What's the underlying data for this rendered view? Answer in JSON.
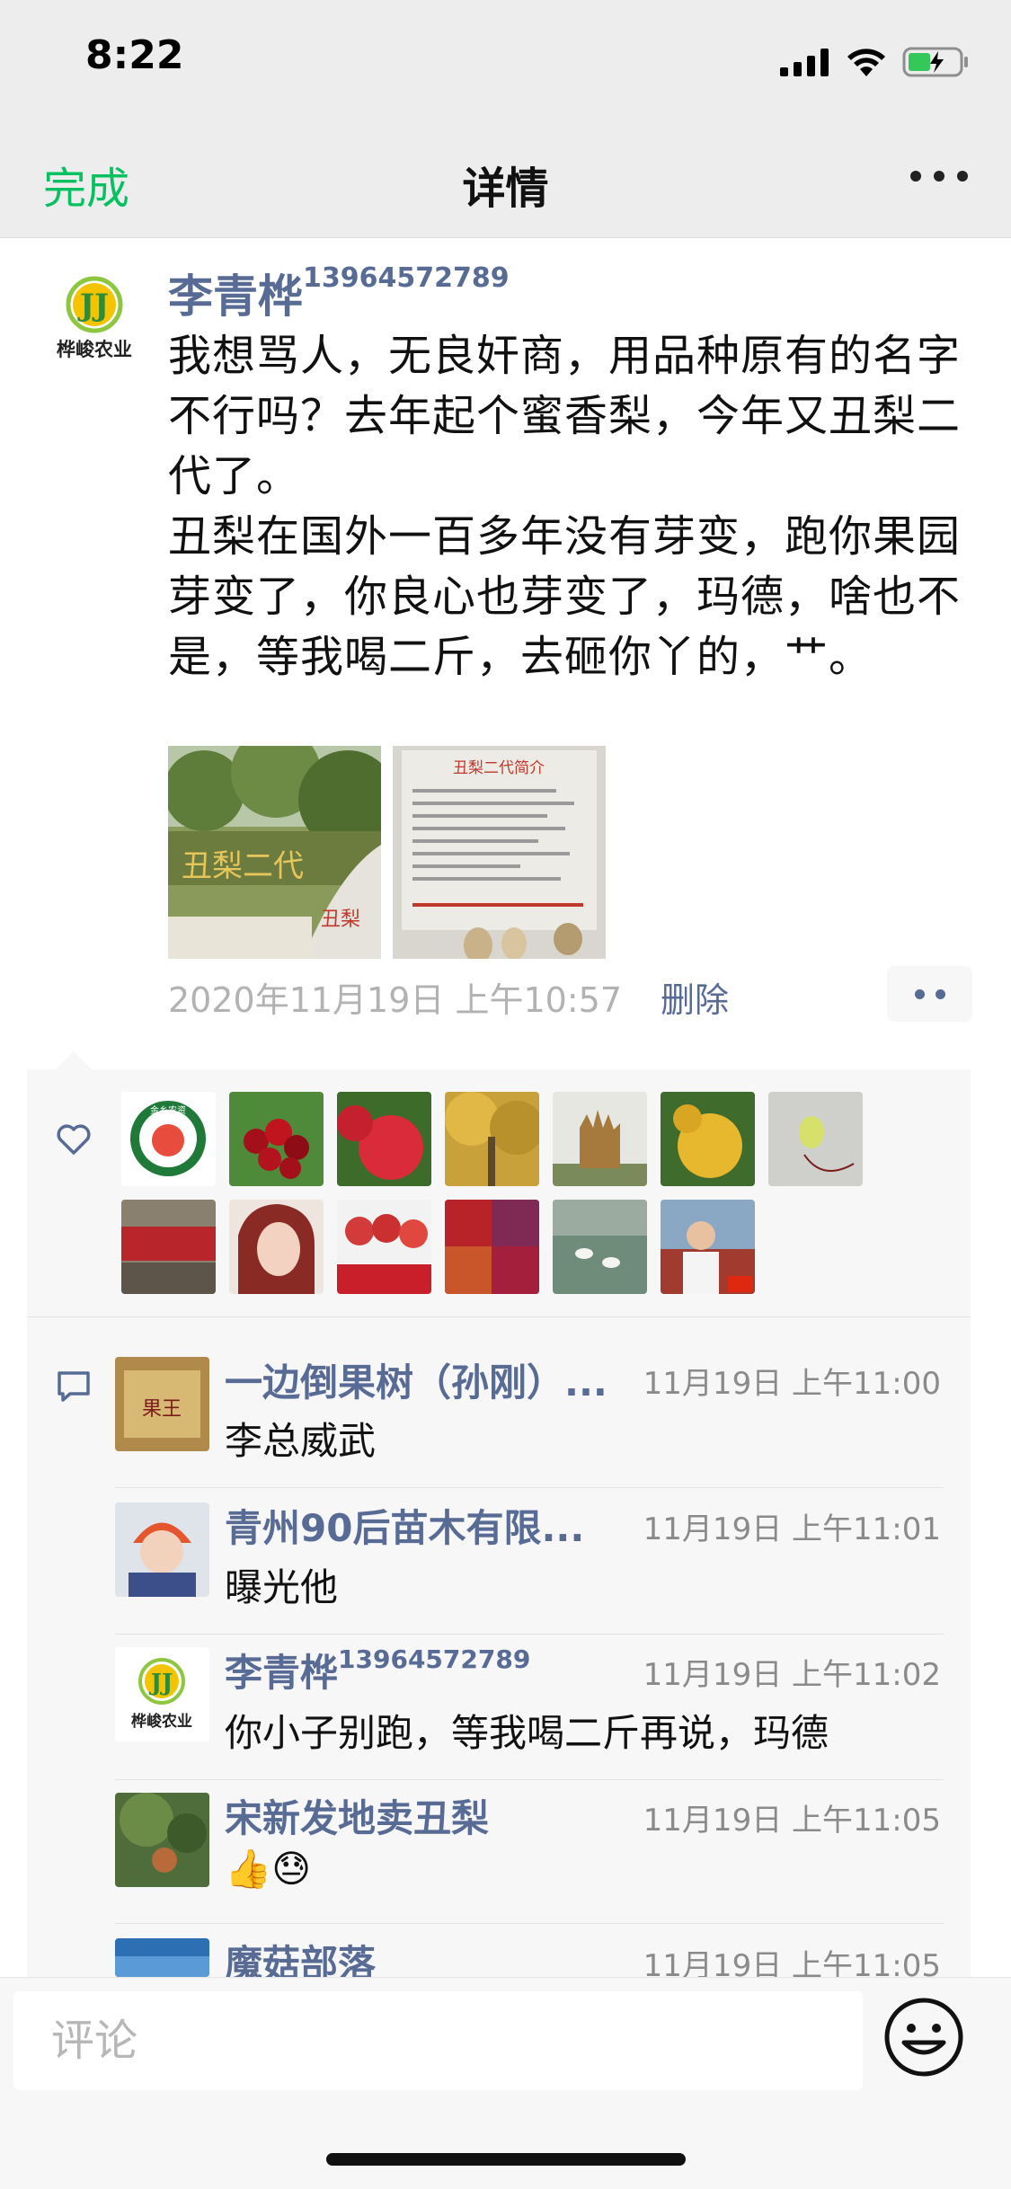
{
  "status_bar": {
    "time": "8:22"
  },
  "nav": {
    "done_label": "完成",
    "title": "详情"
  },
  "post": {
    "author_name": "李青桦",
    "author_phone": "13964572789",
    "avatar_brand": "桦峻农业",
    "avatar_letters": "JJ",
    "text": "我想骂人，无良奸商，用品种原有的名字不行吗？去年起个蜜香梨，今年又丑梨二代了。\n丑梨在国外一百多年没有芽变，跑你果园芽变了，你良心也芽变了，玛德，啥也不是，等我喝二斤，去砸你丫的，艹。",
    "image1_text": "丑梨二代",
    "image1_sub": "丑梨",
    "image2_title": "丑梨二代简介",
    "time": "2020年11月19日 上午10:57",
    "delete_label": "删除"
  },
  "likes": {
    "avatars": [
      "like-avatar-logo",
      "like-avatar-cherries",
      "like-avatar-apples",
      "like-avatar-ginkgo",
      "like-avatar-sculpture",
      "like-avatar-pear",
      "like-avatar-green-fruit",
      "like-avatar-shopfront",
      "like-avatar-woman",
      "like-avatar-peaches",
      "like-avatar-maple",
      "like-avatar-geese",
      "like-avatar-man"
    ],
    "badge_text": "金乡农资"
  },
  "comments": [
    {
      "name": "一边倒果树（孙刚）...",
      "phone": "",
      "time": "11月19日 上午11:00",
      "text": "李总威武",
      "avatar_text": "果王"
    },
    {
      "name": "青州90后苗木有限...",
      "phone": "",
      "time": "11月19日 上午11:01",
      "text": "曝光他",
      "avatar_text": ""
    },
    {
      "name": "李青桦",
      "phone": "13964572789",
      "time": "11月19日 上午11:02",
      "text": "你小子别跑，等我喝二斤再说，玛德",
      "avatar_text": "桦峻农业"
    },
    {
      "name": "宋新发地卖丑梨",
      "phone": "",
      "time": "11月19日 上午11:05",
      "text": "👍😓",
      "avatar_text": ""
    },
    {
      "name": "魔菇部落",
      "phone": "",
      "time": "11月19日 上午11:05",
      "text": "",
      "avatar_text": ""
    }
  ],
  "input": {
    "placeholder": "评论"
  },
  "colors": {
    "accent": "#07c160",
    "link": "#576b95"
  }
}
